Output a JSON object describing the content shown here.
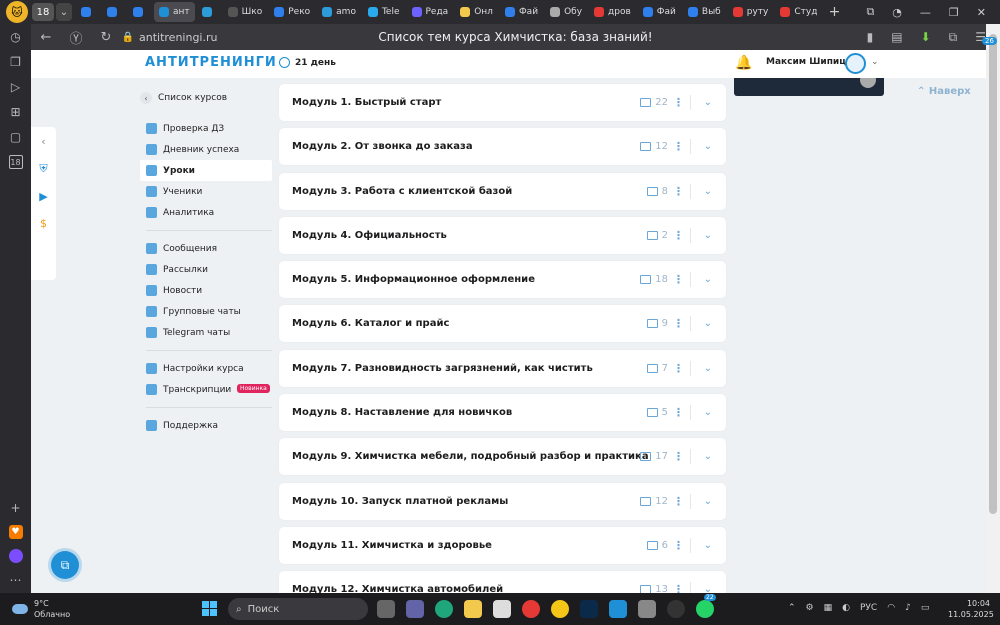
{
  "browser": {
    "tab_counter": "18",
    "tabs": [
      {
        "label": "",
        "color": "#2f80ed"
      },
      {
        "label": "",
        "color": "#2f80ed"
      },
      {
        "label": "",
        "color": "#2f80ed"
      },
      {
        "label": "ант",
        "color": "#1f8fd6"
      },
      {
        "label": "",
        "color": "#2d9cdb"
      },
      {
        "label": "Шко",
        "color": "#555"
      },
      {
        "label": "Реко",
        "color": "#2f80ed"
      },
      {
        "label": "amo",
        "color": "#2d9cdb"
      },
      {
        "label": "Tele",
        "color": "#2aabee"
      },
      {
        "label": "Реда",
        "color": "#6c63ff"
      },
      {
        "label": "Онл",
        "color": "#f2c94c"
      },
      {
        "label": "Фай",
        "color": "#2f80ed"
      },
      {
        "label": "Обу",
        "color": "#aaa"
      },
      {
        "label": "дров",
        "color": "#e53935"
      },
      {
        "label": "Фай",
        "color": "#2f80ed"
      },
      {
        "label": "Выб",
        "color": "#2f80ed"
      },
      {
        "label": "руту",
        "color": "#e53935"
      },
      {
        "label": "Студ",
        "color": "#e53935"
      }
    ],
    "url": "antitreningi.ru",
    "page_title": "Список тем курса Химчистка: база знаний!",
    "sidebar_counter": "18"
  },
  "header": {
    "brand": "АНТИТРЕНИНГИ",
    "days": "21 день",
    "user_name": "Максим Шипицын"
  },
  "nav": {
    "back_label": "Список курсов",
    "group1": [
      {
        "label": "Проверка ДЗ"
      },
      {
        "label": "Дневник успеха"
      },
      {
        "label": "Уроки",
        "active": true
      },
      {
        "label": "Ученики"
      },
      {
        "label": "Аналитика"
      }
    ],
    "group2": [
      {
        "label": "Сообщения"
      },
      {
        "label": "Рассылки"
      },
      {
        "label": "Новости"
      },
      {
        "label": "Групповые чаты"
      },
      {
        "label": "Telegram чаты"
      }
    ],
    "group3": [
      {
        "label": "Настройки курса"
      },
      {
        "label": "Транскрипции",
        "badge": "Новинка"
      }
    ],
    "group4": [
      {
        "label": "Поддержка"
      }
    ]
  },
  "modules": [
    {
      "title": "Модуль 1. Быстрый старт",
      "count": "22"
    },
    {
      "title": "Модуль 2. От звонка до заказа",
      "count": "12"
    },
    {
      "title": "Модуль 3. Работа с клиентской базой",
      "count": "8"
    },
    {
      "title": "Модуль 4. Официальность",
      "count": "2"
    },
    {
      "title": "Модуль 5. Информационное оформление",
      "count": "18"
    },
    {
      "title": "Модуль 6. Каталог и прайс",
      "count": "9"
    },
    {
      "title": "Модуль 7. Разновидность загрязнений, как чистить",
      "count": "7"
    },
    {
      "title": "Модуль 8. Наставление для новичков",
      "count": "5"
    },
    {
      "title": "Модуль 9. Химчистка мебели, подробный разбор и практика",
      "count": "17"
    },
    {
      "title": "Модуль 10. Запуск платной рекламы",
      "count": "12"
    },
    {
      "title": "Модуль 11. Химчистка и здоровье",
      "count": "6"
    },
    {
      "title": "Модуль 12. Химчистка автомобилей",
      "count": "13"
    }
  ],
  "scroll_top_label": "Наверх",
  "scrollbar_badge": "26",
  "taskbar": {
    "temp": "9°C",
    "condition": "Облачно",
    "search_label": "Поиск",
    "lang": "РУС",
    "time": "10:04",
    "date": "11.05.2025",
    "whatsapp_badge": "22"
  }
}
